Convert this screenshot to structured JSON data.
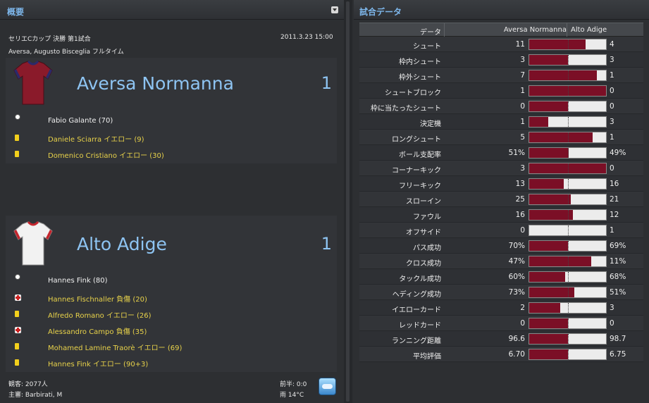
{
  "summary": {
    "title": "概要",
    "match_title": "セリエCカップ 決勝 第1試合",
    "date": "2011.3.23 15:00",
    "venue_info": "Aversa, Augusto Bisceglia フルタイム"
  },
  "home": {
    "name": "Aversa Normanna",
    "score": "1",
    "shirt_color": "#8a1a2a",
    "events": [
      {
        "type": "goal",
        "text": "Fabio Galante (70)"
      },
      {
        "type": "yellow",
        "text": "Daniele Sciarra イエロー (9)"
      },
      {
        "type": "yellow",
        "text": "Domenico Cristiano イエロー (30)"
      }
    ]
  },
  "away": {
    "name": "Alto Adige",
    "score": "1",
    "shirt_color": "#f2f2f2",
    "events": [
      {
        "type": "goal",
        "text": "Hannes Fink (80)"
      },
      {
        "type": "injury",
        "text": "Hannes Fischnaller 負傷 (20)"
      },
      {
        "type": "yellow",
        "text": "Alfredo Romano イエロー (26)"
      },
      {
        "type": "injury",
        "text": "Alessandro Campo 負傷 (35)"
      },
      {
        "type": "yellow",
        "text": "Mohamed Lamine Traorè イエロー (69)"
      },
      {
        "type": "yellow",
        "text": "Hannes Fink イエロー (90+3)"
      }
    ]
  },
  "footer": {
    "attendance": "観客: 2077人",
    "referee": "主審: Barbirati, M",
    "halftime": "前半: 0:0",
    "weather": "雨 14°C",
    "weather_icon": "rain-cloud-icon"
  },
  "stats": {
    "title": "試合データ",
    "header": {
      "label": "データ",
      "home": "Aversa Normanna",
      "away": "Alto Adige"
    },
    "colors": {
      "home": "#7b0f26",
      "away": "#ececec"
    },
    "rows": [
      {
        "label": "シュート",
        "home": "11",
        "away": "4",
        "home_share": 0.73
      },
      {
        "label": "枠内シュート",
        "home": "3",
        "away": "3",
        "home_share": 0.5
      },
      {
        "label": "枠外シュート",
        "home": "7",
        "away": "1",
        "home_share": 0.88
      },
      {
        "label": "シュートブロック",
        "home": "1",
        "away": "0",
        "home_share": 1.0
      },
      {
        "label": "枠に当たったシュート",
        "home": "0",
        "away": "0",
        "home_share": 0.5
      },
      {
        "label": "決定機",
        "home": "1",
        "away": "3",
        "home_share": 0.25
      },
      {
        "label": "ロングシュート",
        "home": "5",
        "away": "1",
        "home_share": 0.83
      },
      {
        "label": "ボール支配率",
        "home": "51%",
        "away": "49%",
        "home_share": 0.51
      },
      {
        "label": "コーナーキック",
        "home": "3",
        "away": "0",
        "home_share": 1.0
      },
      {
        "label": "フリーキック",
        "home": "13",
        "away": "16",
        "home_share": 0.45
      },
      {
        "label": "スローイン",
        "home": "25",
        "away": "21",
        "home_share": 0.54
      },
      {
        "label": "ファウル",
        "home": "16",
        "away": "12",
        "home_share": 0.57
      },
      {
        "label": "オフサイド",
        "home": "0",
        "away": "1",
        "home_share": 0.0
      },
      {
        "label": "パス成功",
        "home": "70%",
        "away": "69%",
        "home_share": 0.5
      },
      {
        "label": "クロス成功",
        "home": "47%",
        "away": "11%",
        "home_share": 0.81
      },
      {
        "label": "タックル成功",
        "home": "60%",
        "away": "68%",
        "home_share": 0.47
      },
      {
        "label": "ヘディング成功",
        "home": "73%",
        "away": "51%",
        "home_share": 0.59
      },
      {
        "label": "イエローカード",
        "home": "2",
        "away": "3",
        "home_share": 0.4
      },
      {
        "label": "レッドカード",
        "home": "0",
        "away": "0",
        "home_share": 0.5
      },
      {
        "label": "ランニング距離",
        "home": "96.6",
        "away": "98.7",
        "home_share": 0.5
      },
      {
        "label": "平均評価",
        "home": "6.70",
        "away": "6.75",
        "home_share": 0.5
      }
    ]
  }
}
